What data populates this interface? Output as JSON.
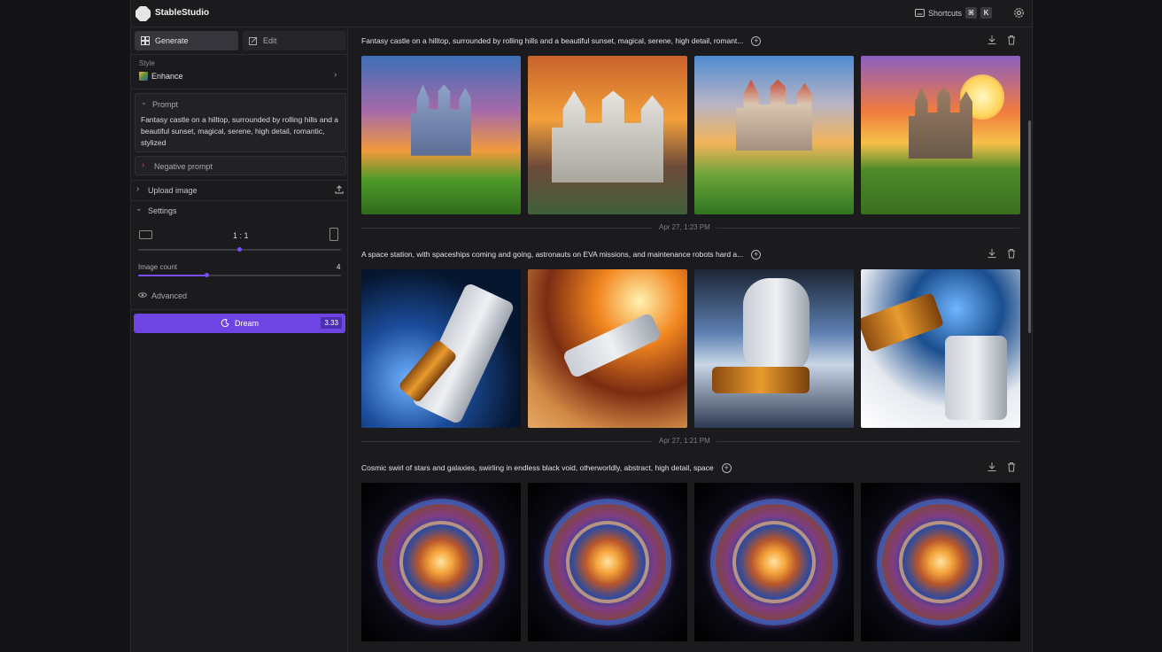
{
  "app": {
    "title": "StableStudio"
  },
  "topbar": {
    "shortcuts_label": "Shortcuts",
    "key_cmd": "⌘",
    "key_k": "K"
  },
  "sidebar": {
    "tabs": [
      {
        "label": "Generate",
        "active": true
      },
      {
        "label": "Edit",
        "active": false
      }
    ],
    "style_label": "Style",
    "style_value": "Enhance",
    "prompt_title": "Prompt",
    "prompt_text": "Fantasy castle on a hilltop, surrounded by rolling hills and a beautiful sunset, magical, serene, high detail, romantic, stylized",
    "negative_prompt_label": "Negative prompt",
    "upload_image_label": "Upload image",
    "settings_label": "Settings",
    "aspect_ratio": "1 : 1",
    "aspect_slider_fraction": 0.5,
    "image_count_label": "Image count",
    "image_count_value": "4",
    "image_count_fraction": 0.33,
    "advanced_label": "Advanced",
    "dream_label": "Dream",
    "dream_cost": "3.33"
  },
  "main": {
    "groups": [
      {
        "prompt": "Fantasy castle on a hilltop, surrounded by rolling hills and a beautiful sunset, magical, serene, high detail, romant...",
        "images": [
          "castle-1",
          "castle-2",
          "castle-3",
          "castle-4"
        ],
        "timestamp_after": "Apr 27, 1:23 PM"
      },
      {
        "prompt": "A space station, with spaceships coming and going, astronauts on EVA missions, and maintenance robots hard a...",
        "images": [
          "space-1",
          "space-2",
          "space-3",
          "space-4"
        ],
        "timestamp_after": "Apr 27, 1:21 PM"
      },
      {
        "prompt": "Cosmic swirl of stars and galaxies, swirling in endless black void, otherworldly, abstract, high detail, space",
        "images": [
          "galaxy",
          "galaxy",
          "galaxy",
          "galaxy"
        ]
      }
    ]
  },
  "colors": {
    "accent": "#6e45e2",
    "background": "#1b1b1e",
    "panel": "#222226"
  },
  "icons": [
    "generate-icon",
    "edit-icon",
    "chevron-right-icon",
    "chevron-down-icon",
    "upload-icon",
    "landscape-icon",
    "portrait-icon",
    "eye-icon",
    "dream-icon",
    "plus-circle-icon",
    "download-icon",
    "trash-icon",
    "gear-icon",
    "keyboard-icon"
  ]
}
